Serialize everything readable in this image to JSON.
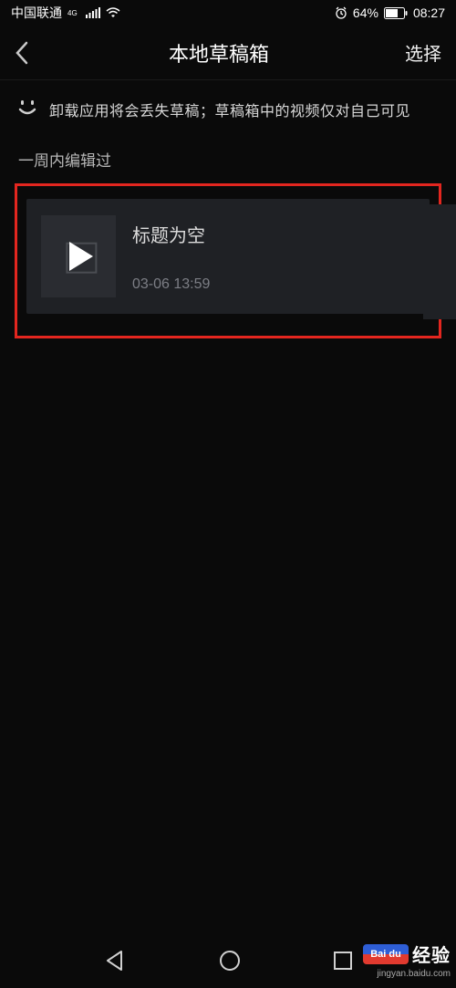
{
  "status": {
    "carrier": "中国联通",
    "network_label": "4G",
    "battery_pct": "64%",
    "time": "08:27"
  },
  "header": {
    "title": "本地草稿箱",
    "select_label": "选择"
  },
  "info": {
    "text": "卸载应用将会丢失草稿；草稿箱中的视频仅对自己可见"
  },
  "section": {
    "label": "一周内编辑过"
  },
  "drafts": [
    {
      "title": "标题为空",
      "timestamp": "03-06 13:59"
    }
  ],
  "watermark": {
    "brand": "Bai du",
    "brand2": "经验",
    "url": "jingyan.baidu.com"
  }
}
